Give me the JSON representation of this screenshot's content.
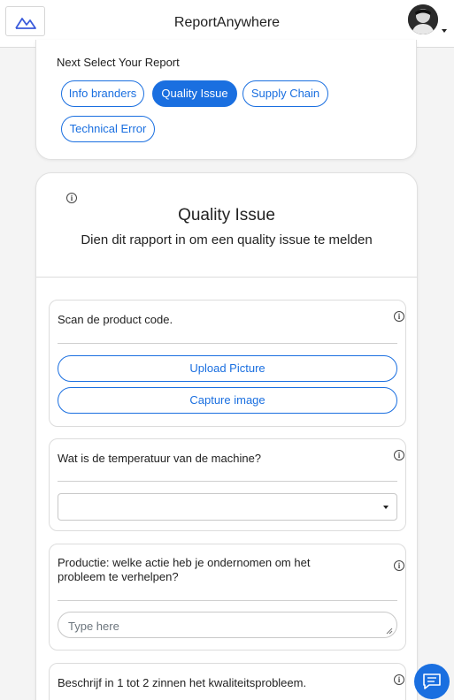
{
  "header": {
    "app_title": "ReportAnywhere",
    "logo_icon": "mountain-logo-icon",
    "avatar_icon": "user-avatar"
  },
  "report_selection": {
    "title": "Next Select Your Report",
    "options": [
      {
        "label": "Info branders",
        "active": false
      },
      {
        "label": "Quality Issue",
        "active": true
      },
      {
        "label": "Supply Chain",
        "active": false
      },
      {
        "label": "Technical Error",
        "active": false
      }
    ]
  },
  "report": {
    "title": "Quality Issue",
    "subtitle": "Dien dit rapport in om een quality issue te melden",
    "info_icon": "info-icon",
    "questions": [
      {
        "text": "Scan de product code.",
        "buttons": [
          "Upload Picture",
          "Capture image"
        ]
      },
      {
        "text": "Wat is de temperatuur van de machine?",
        "select_value": ""
      },
      {
        "text": "Productie: welke actie heb je ondernomen om het probleem te verhelpen?",
        "placeholder": "Type here"
      },
      {
        "text": "Beschrijf in 1 tot 2 zinnen het kwaliteitsprobleem."
      }
    ]
  },
  "chat": {
    "icon": "chat-icon"
  },
  "colors": {
    "accent": "#1a6fe0",
    "background": "#f4f4f4"
  }
}
